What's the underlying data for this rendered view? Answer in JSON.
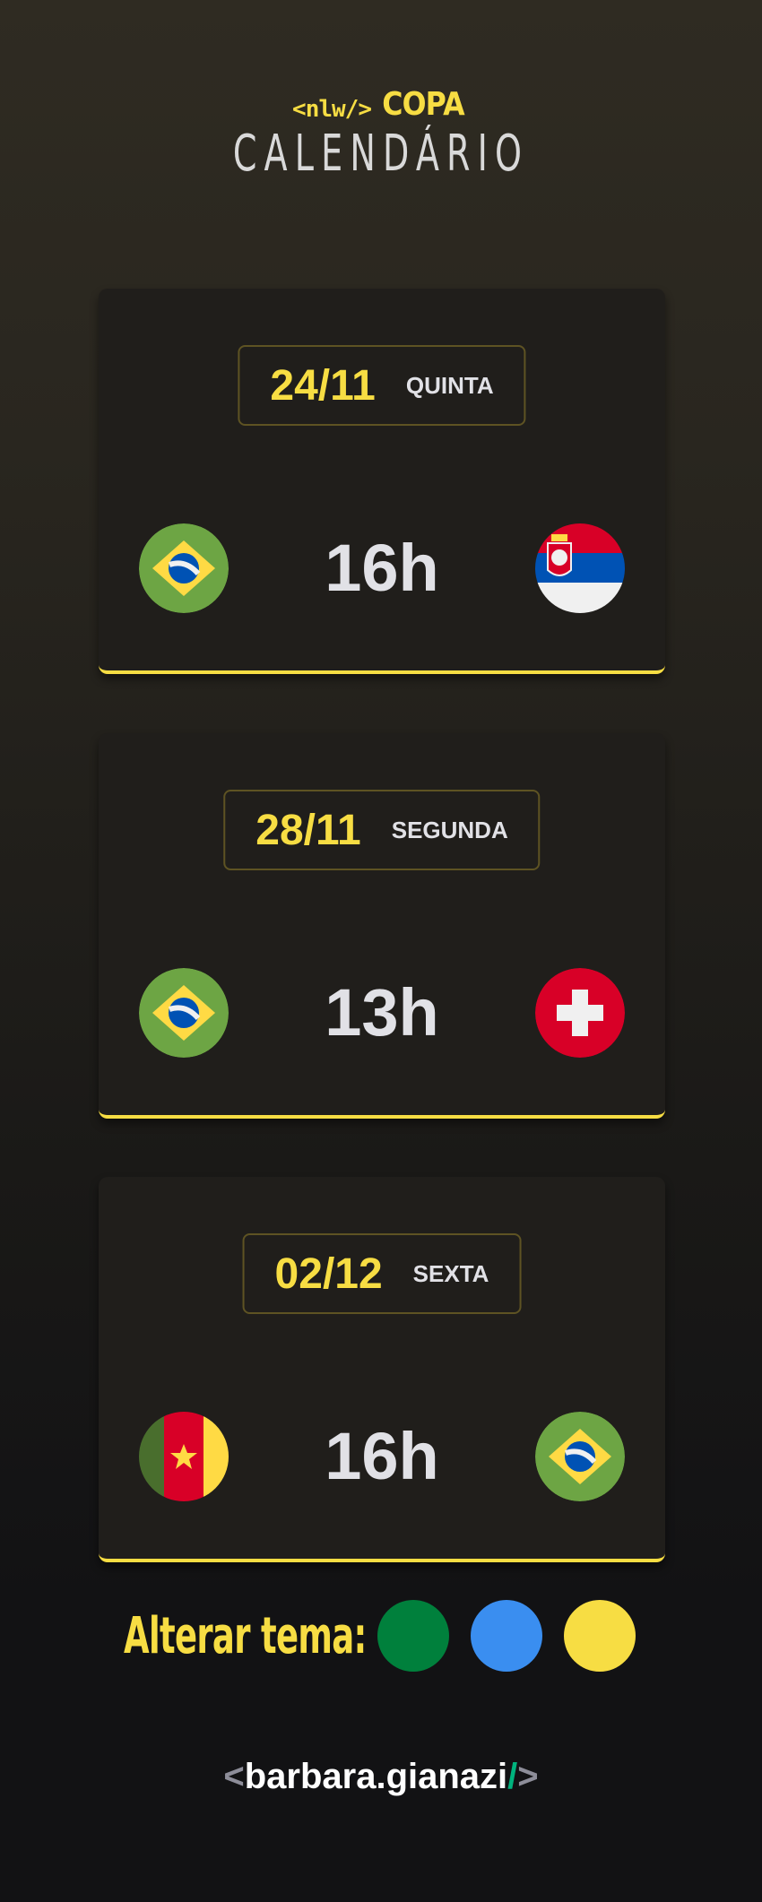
{
  "header": {
    "logo_nlw": "<nlw/>",
    "logo_copa": "COPA",
    "title": "CALENDÁRIO"
  },
  "matches": [
    {
      "date": "24/11",
      "weekday": "QUINTA",
      "time": "16h",
      "home_flag": "brazil-flag-icon",
      "away_flag": "serbia-flag-icon"
    },
    {
      "date": "28/11",
      "weekday": "SEGUNDA",
      "time": "13h",
      "home_flag": "brazil-flag-icon",
      "away_flag": "switzerland-flag-icon"
    },
    {
      "date": "02/12",
      "weekday": "SEXTA",
      "time": "16h",
      "home_flag": "cameroon-flag-icon",
      "away_flag": "brazil-flag-icon"
    }
  ],
  "theme": {
    "label": "Alterar tema:",
    "options": [
      {
        "name": "green",
        "color": "#00803c"
      },
      {
        "name": "blue",
        "color": "#3a8ef0"
      },
      {
        "name": "yellow",
        "color": "#f7dd43"
      }
    ]
  },
  "footer": {
    "open": "<",
    "name": "barbara.gianazi",
    "slash": "/",
    "close": ">"
  },
  "colors": {
    "accent": "#f7dd43",
    "card": "#201e1b",
    "text": "#e1e1e6"
  }
}
